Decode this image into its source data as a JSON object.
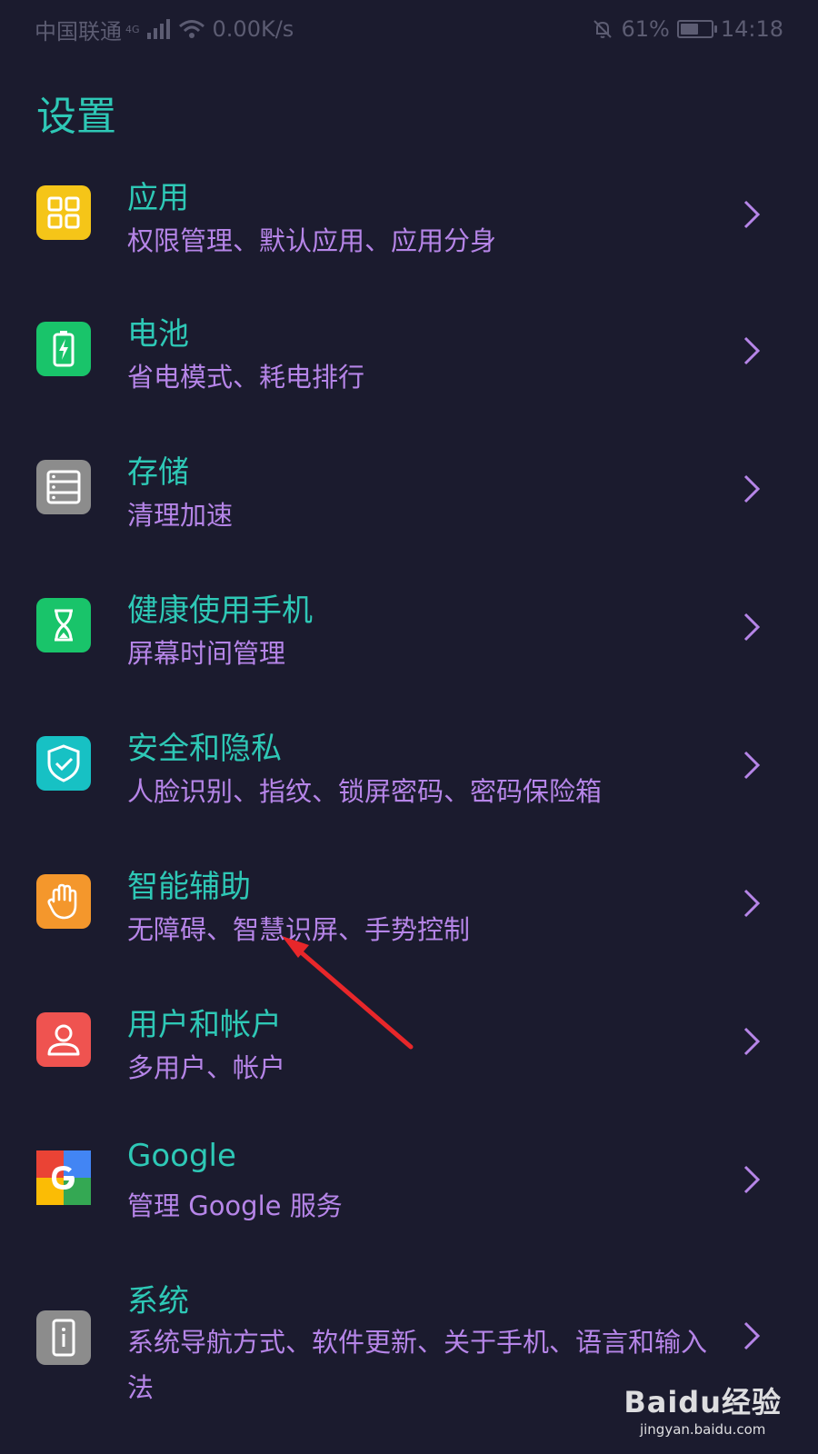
{
  "status_bar": {
    "carrier": "中国联通",
    "network": "4G",
    "speed": "0.00K/s",
    "battery_pct": "61%",
    "battery_level": 0.61,
    "time": "14:18"
  },
  "page_title": "设置",
  "items": [
    {
      "label": "应用",
      "desc": "权限管理、默认应用、应用分身",
      "icon": "apps-grid-icon",
      "icon_bg": "#f5c518"
    },
    {
      "label": "电池",
      "desc": "省电模式、耗电排行",
      "icon": "battery-icon",
      "icon_bg": "#19c46a"
    },
    {
      "label": "存储",
      "desc": "清理加速",
      "icon": "storage-icon",
      "icon_bg": "#8c8c8c"
    },
    {
      "label": "健康使用手机",
      "desc": "屏幕时间管理",
      "icon": "hourglass-icon",
      "icon_bg": "#19c46a"
    },
    {
      "label": "安全和隐私",
      "desc": "人脸识别、指纹、锁屏密码、密码保险箱",
      "icon": "shield-check-icon",
      "icon_bg": "#17c1c4"
    },
    {
      "label": "智能辅助",
      "desc": "无障碍、智慧识屏、手势控制",
      "icon": "hand-icon",
      "icon_bg": "#f4972c"
    },
    {
      "label": "用户和帐户",
      "desc": "多用户、帐户",
      "icon": "user-icon",
      "icon_bg": "#ef5350"
    },
    {
      "label": "Google",
      "desc": "管理 Google 服务",
      "icon": "google-icon",
      "icon_bg": "#ffffff"
    },
    {
      "label": "系统",
      "desc": "系统导航方式、软件更新、关于手机、语言和输入法",
      "icon": "phone-info-icon",
      "icon_bg": "#8c8c8c"
    }
  ],
  "colors": {
    "background": "#1b1b2e",
    "title": "#2ec8b6",
    "desc": "#b685e8",
    "chevron": "#b685e8",
    "annotation_arrow": "#e8272a"
  },
  "watermark": {
    "logo": "Baidu经验",
    "url": "jingyan.baidu.com"
  }
}
